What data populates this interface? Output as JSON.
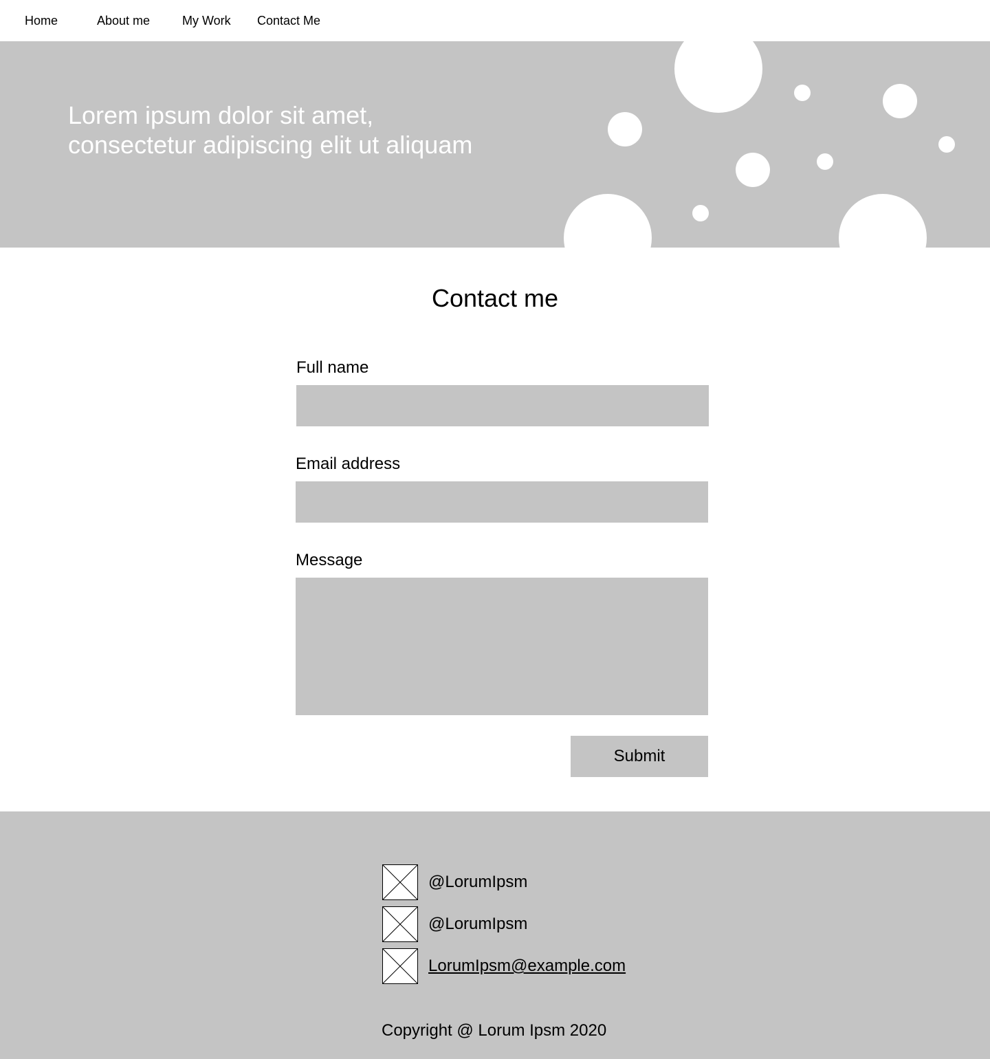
{
  "nav": {
    "items": [
      {
        "label": "Home"
      },
      {
        "label": "About me"
      },
      {
        "label": "My Work"
      },
      {
        "label": "Contact Me"
      }
    ]
  },
  "hero": {
    "line1": "Lorem ipsum dolor sit amet,",
    "line2": "consectetur adipiscing elit ut aliquam",
    "background_color": "#c4c4c4",
    "bubble_color": "#ffffff"
  },
  "contact": {
    "title": "Contact me",
    "full_name_label": "Full name",
    "full_name_value": "",
    "email_label": "Email address",
    "email_value": "",
    "message_label": "Message",
    "message_value": "",
    "submit_label": "Submit"
  },
  "footer": {
    "socials": [
      {
        "icon": "image-placeholder-icon",
        "text": "@LorumIpsm"
      },
      {
        "icon": "image-placeholder-icon",
        "text": "@LorumIpsm"
      },
      {
        "icon": "image-placeholder-icon",
        "text": "LorumIpsm@example.com"
      }
    ],
    "copyright": "Copyright @ Lorum Ipsm 2020"
  },
  "colors": {
    "placeholder_gray": "#c4c4c4",
    "text": "#000000",
    "hero_text": "#ffffff"
  }
}
